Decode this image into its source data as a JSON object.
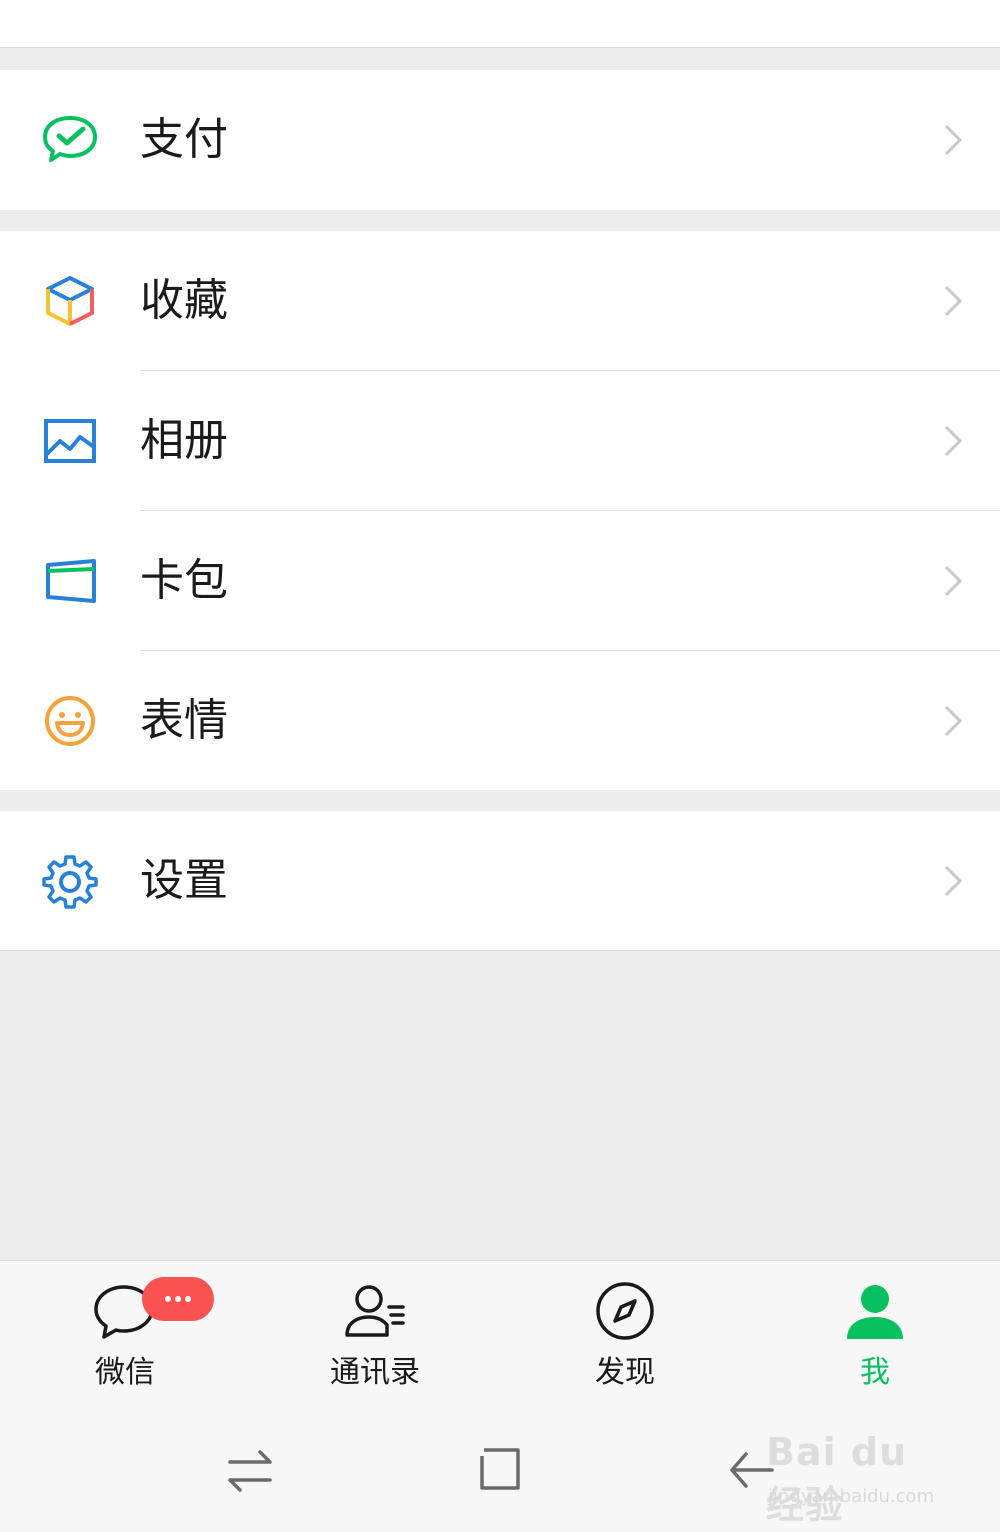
{
  "menu": {
    "pay": "支付",
    "favorites": "收藏",
    "album": "相册",
    "cards": "卡包",
    "stickers": "表情",
    "settings": "设置"
  },
  "tabbar": {
    "chats": "微信",
    "contacts": "通讯录",
    "discover": "发现",
    "me": "我",
    "active": "me",
    "chats_badge": "..."
  },
  "watermark": {
    "main": "Bai du 经验",
    "sub": "jingyan.baidu.com"
  },
  "colors": {
    "accent": "#07c160",
    "badge": "#fa5151",
    "blue_icon": "#2782d7",
    "orange_icon": "#f4a23c"
  }
}
